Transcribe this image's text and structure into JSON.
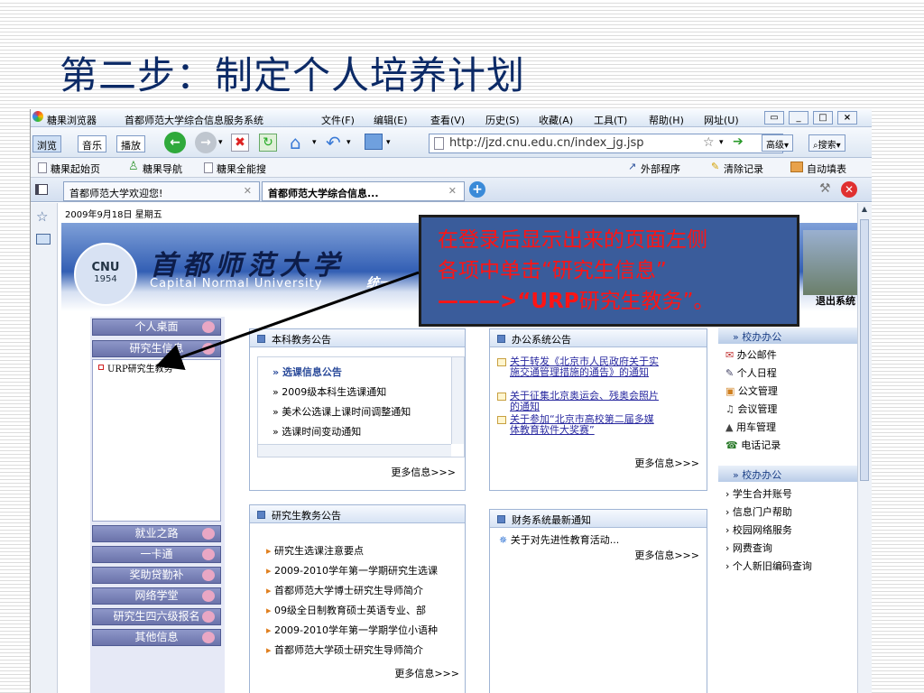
{
  "slide": {
    "title": "第二步：制定个人培养计划"
  },
  "browser": {
    "app_name": "糖果浏览器",
    "window_title": "首都师范大学综合信息服务系统",
    "menus": [
      "文件(F)",
      "编辑(E)",
      "查看(V)",
      "历史(S)",
      "收藏(A)",
      "工具(T)",
      "帮助(H)",
      "网址(U)"
    ],
    "window_buttons": [
      "▭",
      "_",
      "□",
      "×"
    ],
    "toolbar_tabs": [
      "浏览",
      "音乐",
      "播放"
    ],
    "url": "http://jzd.cnu.edu.cn/index_jg.jsp",
    "advanced_label": "高级",
    "search_label": "搜索",
    "favorites": [
      "糖果起始页",
      "糖果导航",
      "糖果全能搜"
    ],
    "fav_tools": [
      "外部程序",
      "清除记录",
      "自动填表"
    ],
    "page_tabs": [
      "首都师范大学欢迎您!",
      "首都师范大学综合信息..."
    ]
  },
  "portal": {
    "date": "2009年9月18日 星期五",
    "logo_text": "CNU",
    "logo_year": "1954",
    "school_name_cn": "首都师范大学",
    "school_name_en": "Capital Normal University",
    "system_label": "统一",
    "logout": "退出系统",
    "nav_top": [
      "个人桌面",
      "研究生信息"
    ],
    "nav_sub": "URP研究生教务",
    "nav_bottom": [
      "就业之路",
      "一卡通",
      "奖助贷勤补",
      "网络学堂",
      "研究生四六级报名",
      "其他信息"
    ],
    "panels": {
      "undergrad": {
        "title": "本科教务公告",
        "items": [
          "选课信息公告",
          "2009级本科生选课通知",
          "美术公选课上课时间调整通知",
          "选课时间变动通知"
        ],
        "more": "更多信息>>>"
      },
      "office": {
        "title": "办公系统公告",
        "items": [
          "关于转发《北京市人民政府关于实施交通管理措施的通告》的通知",
          "关于征集北京奥运会、残奥会照片的通知",
          "关于参加“北京市高校第二届多媒体教育软件大奖赛”"
        ],
        "more": "更多信息>>>"
      },
      "grad": {
        "title": "研究生教务公告",
        "items": [
          "研究生选课注意要点",
          "2009-2010学年第一学期研究生选课",
          "首都师范大学博士研究生导师简介",
          "09级全日制教育硕士英语专业、部",
          "2009-2010学年第一学期学位小语种",
          "首都师范大学硕士研究生导师简介"
        ],
        "more": "更多信息>>>"
      },
      "finance": {
        "title": "财务系统最新通知",
        "items": [
          "关于对先进性教育活动..."
        ],
        "more": "更多信息>>>"
      }
    },
    "right_office": {
      "title": "校办办公",
      "items": [
        "办公邮件",
        "个人日程",
        "公文管理",
        "会议管理",
        "用车管理",
        "电话记录"
      ]
    },
    "right_school": {
      "title": "校办办公",
      "items": [
        "学生合并账号",
        "信息门户帮助",
        "校园网络服务",
        "网费查询",
        "个人新旧编码查询"
      ]
    }
  },
  "callout": {
    "line1": "在登录后显示出来的页面左侧",
    "line2": "各项中单击“研究生信息”",
    "line3_prefix": "———>“",
    "line3_bold": "URP",
    "line3_suffix": "研究生教务”。"
  }
}
